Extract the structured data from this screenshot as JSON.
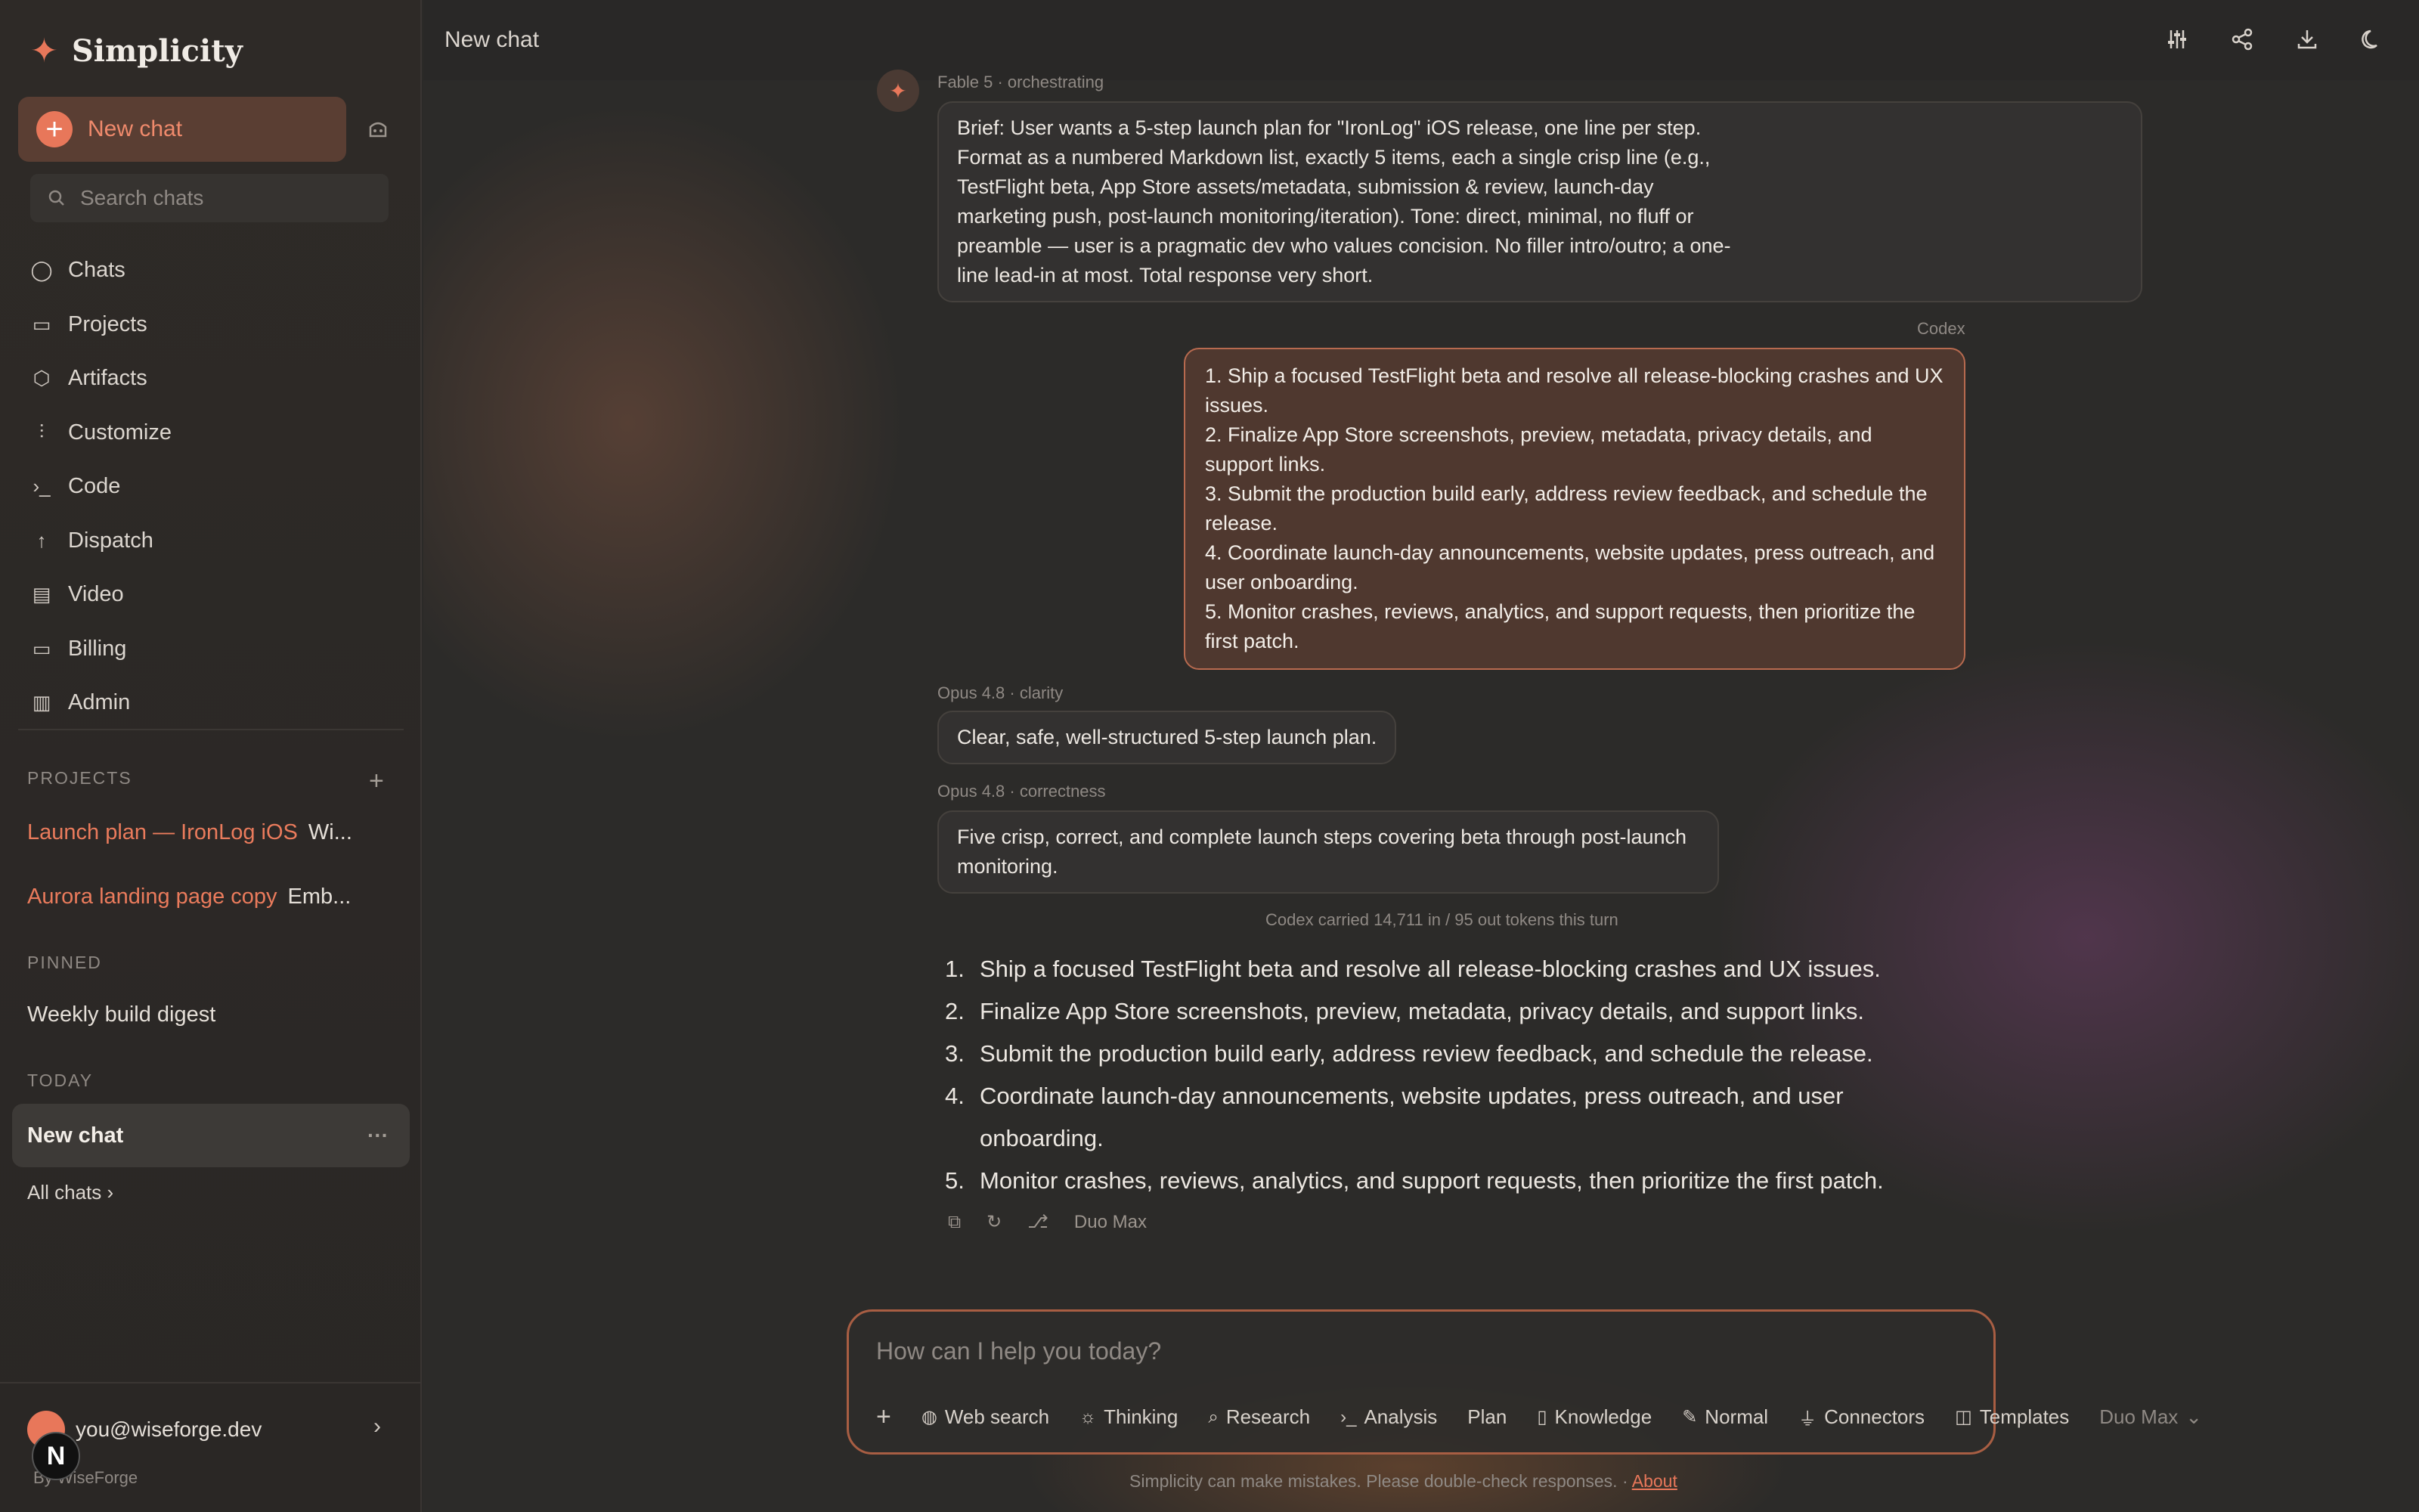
{
  "app": {
    "name": "Simplicity"
  },
  "sidebar": {
    "new_chat": "New chat",
    "search_placeholder": "Search chats",
    "nav": [
      {
        "label": "Chats",
        "icon": "chat-bubble-icon"
      },
      {
        "label": "Projects",
        "icon": "folder-icon"
      },
      {
        "label": "Artifacts",
        "icon": "cube-icon"
      },
      {
        "label": "Customize",
        "icon": "sliders-icon"
      },
      {
        "label": "Code",
        "icon": "terminal-icon"
      },
      {
        "label": "Dispatch",
        "icon": "arrow-up-icon"
      },
      {
        "label": "Video",
        "icon": "film-icon"
      },
      {
        "label": "Billing",
        "icon": "card-icon"
      },
      {
        "label": "Admin",
        "icon": "bar-chart-icon"
      }
    ],
    "projects_label": "PROJECTS",
    "projects": [
      {
        "name": "Launch plan — IronLog iOS",
        "desc": "Wi..."
      },
      {
        "name": "Aurora landing page copy",
        "desc": "Emb..."
      }
    ],
    "pinned_label": "PINNED",
    "pinned": [
      "Weekly build digest"
    ],
    "today_label": "TODAY",
    "today": [
      "New chat"
    ],
    "all_chats": "All chats",
    "user_email": "you@wiseforge.dev",
    "byline": "By WiseForge",
    "badge": "N"
  },
  "header": {
    "title": "New chat"
  },
  "messages": {
    "orchestrator_meta": "Fable 5 · orchestrating",
    "brief": "Brief: User wants a 5-step launch plan for \"IronLog\" iOS release, one line per step. Format as a numbered Markdown list, exactly 5 items, each a single crisp line (e.g., TestFlight beta, App Store assets/metadata, submission & review, launch-day marketing push, post-launch monitoring/iteration). Tone: direct, minimal, no fluff or preamble — user is a pragmatic dev who values concision. No filler intro/outro; a one-line lead-in at most. Total response very short.",
    "codex_meta": "Codex",
    "codex_items": [
      "1. Ship a focused TestFlight beta and resolve all release-blocking crashes and UX issues.",
      "2. Finalize App Store screenshots, preview, metadata, privacy details, and support links.",
      "3. Submit the production build early, address review feedback, and schedule the release.",
      "4. Coordinate launch-day announcements, website updates, press outreach, and user onboarding.",
      "5. Monitor crashes, reviews, analytics, and support requests, then prioritize the first patch."
    ],
    "clarity_meta": "Opus 4.8 · clarity",
    "clarity": "Clear, safe, well-structured 5-step launch plan.",
    "correctness_meta": "Opus 4.8 · correctness",
    "correctness": "Five crisp, correct, and complete launch steps covering beta through post-launch monitoring.",
    "tokens": "Codex carried 14,711 in / 95 out tokens this turn",
    "final_nums": [
      "1.",
      "2.",
      "3.",
      "4.",
      "5."
    ],
    "final_items": [
      "Ship a focused TestFlight beta and resolve all release-blocking crashes and UX issues.",
      "Finalize App Store screenshots, preview, metadata, privacy details, and support links.",
      "Submit the production build early, address review feedback, and schedule the release.",
      "Coordinate launch-day announcements, website updates, press outreach, and user onboarding.",
      "Monitor crashes, reviews, analytics, and support requests, then prioritize the first patch."
    ],
    "model_label": "Duo Max"
  },
  "composer": {
    "placeholder": "How can I help you today?",
    "tools": [
      "Web search",
      "Thinking",
      "Research",
      "Analysis",
      "Plan",
      "Knowledge",
      "Normal",
      "Connectors",
      "Templates"
    ],
    "model": "Duo Max"
  },
  "footer": {
    "note": "Simplicity can make mistakes. Please double-check responses. ·",
    "link": "About"
  },
  "colors": {
    "accent": "#e8775a",
    "codex_border": "#b86a4f"
  }
}
